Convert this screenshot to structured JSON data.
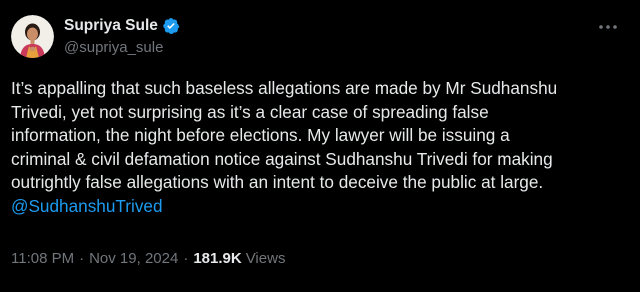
{
  "author": {
    "display_name": "Supriya Sule",
    "handle": "@supriya_sule",
    "verified_icon": "verified-badge-icon",
    "avatar_icon": "profile-avatar"
  },
  "tweet": {
    "lines": [
      "It’s appalling that such baseless allegations are made by Mr Sudhanshu",
      "Trivedi, yet not surprising as it’s a clear case of spreading false",
      "information, the night before elections. My lawyer will be issuing a",
      "criminal & civil defamation notice against Sudhanshu Trivedi for making",
      "outrightly false allegations with an intent to deceive the public at large."
    ],
    "mention": "@SudhanshuTrived"
  },
  "meta": {
    "time": "11:08 PM",
    "separator": "·",
    "date": "Nov 19, 2024",
    "views_count": "181.9K",
    "views_label": "Views"
  },
  "colors": {
    "background": "#000000",
    "text": "#e7e9ea",
    "secondary": "#71767b",
    "link": "#1d9bf0"
  }
}
